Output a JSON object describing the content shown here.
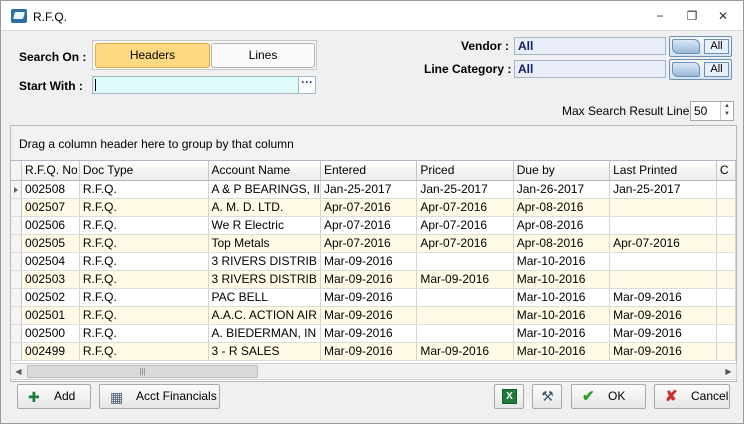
{
  "window": {
    "title": "R.F.Q.",
    "min_icon": "minimize-icon",
    "max_icon": "restore-icon",
    "close_icon": "close-icon"
  },
  "search": {
    "search_on_label": "Search On :",
    "headers_label": "Headers",
    "lines_label": "Lines",
    "active_mode": "Headers",
    "start_with_label": "Start With :",
    "start_with_value": "",
    "browse_label": "···"
  },
  "filters": {
    "vendor_label": "Vendor :",
    "vendor_value": "All",
    "vendor_btn": "All",
    "line_category_label": "Line Category :",
    "line_category_value": "All",
    "line_category_btn": "All",
    "max_lines_label": "Max Search Result Lines :",
    "max_lines_value": "50"
  },
  "grid": {
    "group_hint": "Drag a column header here to group by that column",
    "columns": [
      "R.F.Q. No",
      "Doc Type",
      "Account Name",
      "Entered",
      "Priced",
      "Due by",
      "Last Printed",
      "C"
    ],
    "rows": [
      [
        "002508",
        "R.F.Q.",
        "A & P BEARINGS, II",
        "Jan-25-2017",
        "Jan-25-2017",
        "Jan-26-2017",
        "Jan-25-2017",
        ""
      ],
      [
        "002507",
        "R.F.Q.",
        "A. M. D. LTD.",
        "Apr-07-2016",
        "Apr-07-2016",
        "Apr-08-2016",
        "",
        ""
      ],
      [
        "002506",
        "R.F.Q.",
        "We R Electric",
        "Apr-07-2016",
        "Apr-07-2016",
        "Apr-08-2016",
        "",
        ""
      ],
      [
        "002505",
        "R.F.Q.",
        "Top Metals",
        "Apr-07-2016",
        "Apr-07-2016",
        "Apr-08-2016",
        "Apr-07-2016",
        ""
      ],
      [
        "002504",
        "R.F.Q.",
        "3 RIVERS DISTRIB",
        "Mar-09-2016",
        "",
        "Mar-10-2016",
        "",
        ""
      ],
      [
        "002503",
        "R.F.Q.",
        "3 RIVERS DISTRIB",
        "Mar-09-2016",
        "Mar-09-2016",
        "Mar-10-2016",
        "",
        ""
      ],
      [
        "002502",
        "R.F.Q.",
        "PAC BELL",
        "Mar-09-2016",
        "",
        "Mar-10-2016",
        "Mar-09-2016",
        ""
      ],
      [
        "002501",
        "R.F.Q.",
        "A.A.C. ACTION AIR",
        "Mar-09-2016",
        "",
        "Mar-10-2016",
        "Mar-09-2016",
        ""
      ],
      [
        "002500",
        "R.F.Q.",
        "A. BIEDERMAN, IN",
        "Mar-09-2016",
        "",
        "Mar-10-2016",
        "Mar-09-2016",
        ""
      ],
      [
        "002499",
        "R.F.Q.",
        "3 - R SALES",
        "Mar-09-2016",
        "Mar-09-2016",
        "Mar-10-2016",
        "Mar-09-2016",
        ""
      ]
    ],
    "scroll_thumb_grip": "|||"
  },
  "footer": {
    "add_label": "Add",
    "acct_label": "Acct Financials",
    "ok_label": "OK",
    "cancel_label": "Cancel"
  },
  "colors": {
    "active_toggle": "#ffd981",
    "alt_row": "#fffbe6",
    "input_bg": "#dffcfb"
  }
}
